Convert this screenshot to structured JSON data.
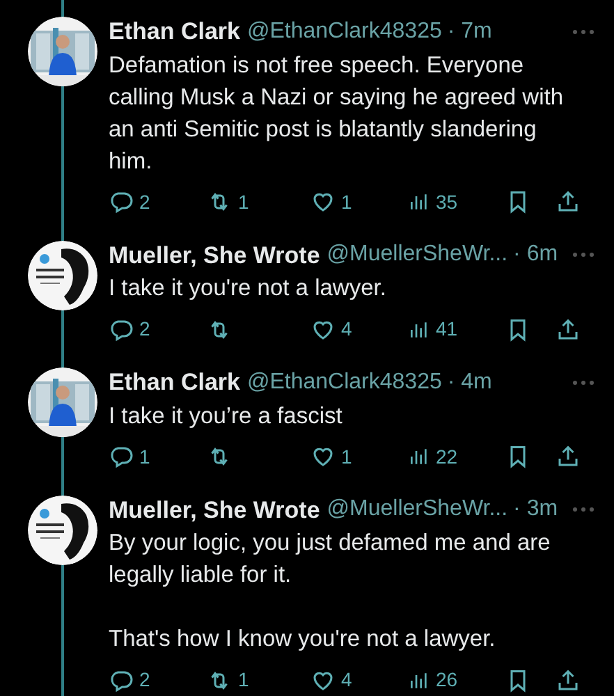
{
  "tweets": [
    {
      "name": "Ethan Clark",
      "handle": "@EthanClark48325",
      "time": "· 7m",
      "paragraphs": [
        "Defamation is not free speech. Everyone calling Musk a Nazi or saying he agreed with an anti Semitic post is blatantly slandering him."
      ],
      "replies": "2",
      "reposts": "1",
      "likes": "1",
      "views": "35"
    },
    {
      "name": "Mueller, She Wrote",
      "handle": "@MuellerSheWr...",
      "time": "· 6m",
      "paragraphs": [
        "I take it you're not a lawyer."
      ],
      "replies": "2",
      "likes": "4",
      "views": "41"
    },
    {
      "name": "Ethan Clark",
      "handle": "@EthanClark48325",
      "time": "· 4m",
      "paragraphs": [
        "I take it you’re a fascist"
      ],
      "replies": "1",
      "likes": "1",
      "views": "22"
    },
    {
      "name": "Mueller, She Wrote",
      "handle": "@MuellerSheWr...",
      "time": "· 3m",
      "paragraphs": [
        "By your logic, you just defamed me and are legally liable for it.",
        "That's how I know you're not a lawyer."
      ],
      "replies": "2",
      "reposts": "1",
      "likes": "4",
      "views": "26"
    }
  ]
}
